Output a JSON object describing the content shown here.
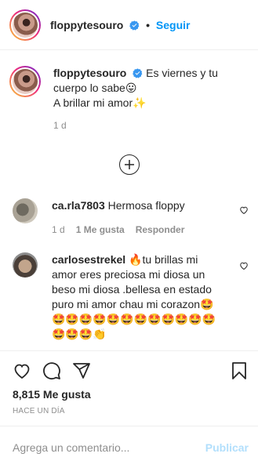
{
  "header": {
    "username": "floppytesouro",
    "separator": "•",
    "follow_label": "Seguir"
  },
  "caption": {
    "username": "floppytesouro",
    "text": "Es viernes y tu cuerpo lo sabe😛\nA brillar mi amor✨",
    "time": "1 d"
  },
  "comments": [
    {
      "username": "ca.rla7803",
      "text": "Hermosa floppy",
      "time": "1 d",
      "likes": "1 Me gusta",
      "reply_label": "Responder"
    },
    {
      "username": "carlosestrekel",
      "text": "🔥tu brillas mi amor eres preciosa mi diosa un beso mi diosa .bellesa en estado puro mi amor chau mi corazon🤩🤩🤩🤩🤩🤩🤩🤩🤩🤩🤩🤩🤩🤩🤩🤩👏"
    }
  ],
  "post": {
    "likes": "8,815 Me gusta",
    "date": "HACE UN DÍA"
  },
  "comment_box": {
    "placeholder": "Agrega un comentario...",
    "publish_label": "Publicar"
  },
  "colors": {
    "accent": "#0095f6",
    "publish_disabled": "#b2dffc",
    "secondary_text": "#8e8e8e",
    "primary_text": "#262626"
  }
}
